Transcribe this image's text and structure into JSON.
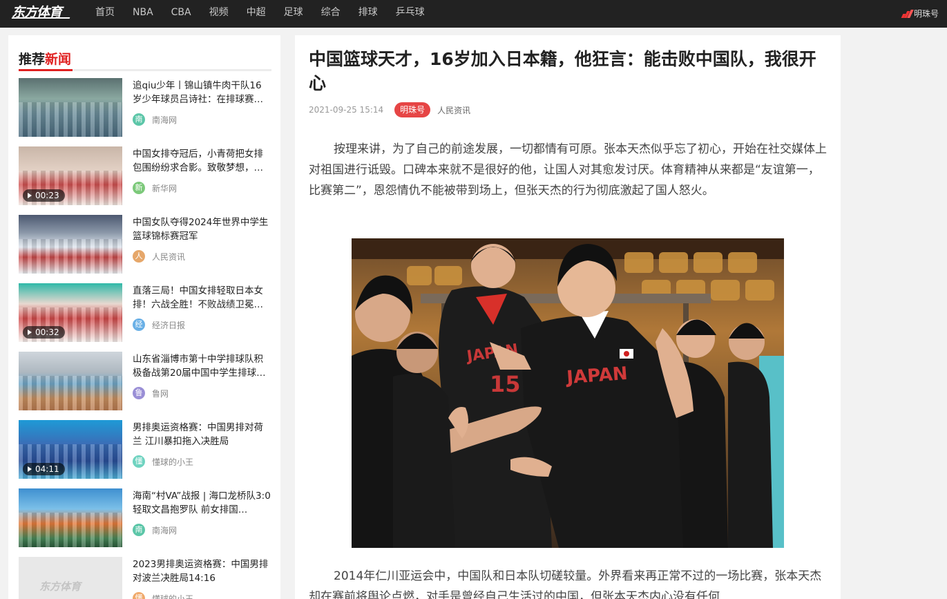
{
  "site": {
    "logo": "东方体育",
    "nav": [
      "首页",
      "NBA",
      "CBA",
      "视频",
      "中超",
      "足球",
      "综合",
      "排球",
      "乒乓球"
    ],
    "mingzhu_link": "明珠号"
  },
  "sidebar": {
    "title_prefix": "推荐",
    "title_highlight": "新闻",
    "items": [
      {
        "title": "追qiu少年丨锦山镇牛肉干队16岁少年球员吕诗社：在排球赛…",
        "source": "南海网",
        "avatar": "南",
        "avatar_color": "#5cc6a8",
        "duration": ""
      },
      {
        "title": "中国女排夺冠后，小青荷把女排包围纷纷求合影。致敬梦想，…",
        "source": "新华网",
        "avatar": "新",
        "avatar_color": "#7cc97a",
        "duration": "00:23"
      },
      {
        "title": "中国女队夺得2024年世界中学生篮球锦标赛冠军",
        "source": "人民资讯",
        "avatar": "人",
        "avatar_color": "#e6a76a",
        "duration": ""
      },
      {
        "title": "直落三局！中国女排轻取日本女排！六战全胜！不败战绩卫冕…",
        "source": "经济日报",
        "avatar": "经",
        "avatar_color": "#6ab0e6",
        "duration": "00:32"
      },
      {
        "title": "山东省淄博市第十中学排球队积极备战第20届中国中学生排球…",
        "source": "鲁网",
        "avatar": "鲁",
        "avatar_color": "#9a8fd6",
        "duration": ""
      },
      {
        "title": "男排奥运资格赛：中国男排对荷兰 江川暴扣拖入决胜局",
        "source": "懂球的小王",
        "avatar": "懂",
        "avatar_color": "#6fd3c0",
        "duration": "04:11"
      },
      {
        "title": "海南“村VA”战报 | 海口龙桥队3:0轻取文昌抱罗队 前女排国…",
        "source": "南海网",
        "avatar": "南",
        "avatar_color": "#5cc6a8",
        "duration": ""
      },
      {
        "title": "2023男排奥运资格赛：中国男排对波兰决胜局14:16",
        "source": "懂球的小王",
        "avatar": "懂",
        "avatar_color": "#f0a96a",
        "duration": ""
      }
    ]
  },
  "article": {
    "title": "中国篮球天才，16岁加入日本籍，他狂言：能击败中国队，我很开心",
    "time": "2021-09-25 15:14",
    "badge": "明珠号",
    "source": "人民资讯",
    "paragraph1": "按理来讲，为了自己的前途发展，一切都情有可原。张本天杰似乎忘了初心，开始在社交媒体上对祖国进行诋毁。口碑本来就不是很好的他，让国人对其愈发讨厌。体育精神从来都是“友谊第一，比赛第二”，恩怨情仇不能被带到场上，但张天杰的行为彻底激起了国人怒火。",
    "paragraph2": "2014年仁川亚运会中，中国队和日本队切磋较量。外界看来再正常不过的一场比赛，张本天杰却在赛前将舆论点燃，对手是曾经自己生活过的中国，但张本天杰内心没有任何",
    "photo_jersey_text": "JAPAN",
    "photo_jersey_number": "15"
  },
  "colors": {
    "accent": "#e02020",
    "topbar": "#222222",
    "badge": "#e64545"
  }
}
